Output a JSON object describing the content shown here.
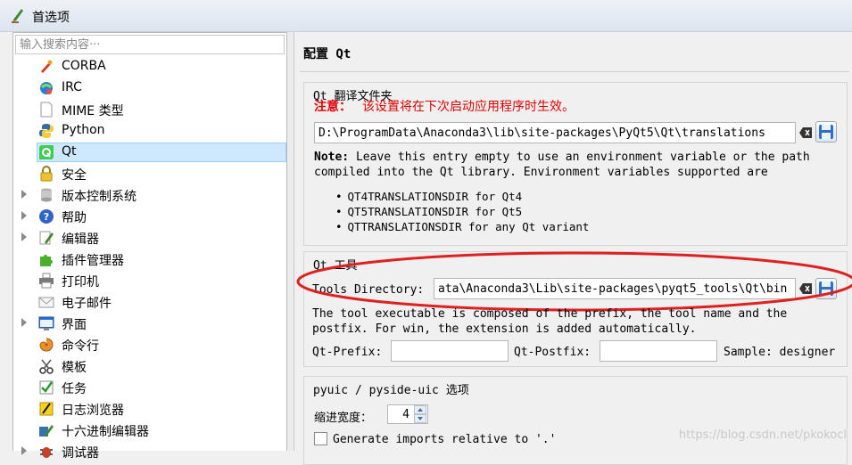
{
  "window": {
    "title": "首选项"
  },
  "sidebar": {
    "search_placeholder": "输入搜索内容···",
    "items": [
      {
        "label": "CORBA",
        "icon": "corba-icon",
        "expandable": false,
        "selected": false
      },
      {
        "label": "IRC",
        "icon": "irc-icon",
        "expandable": false,
        "selected": false
      },
      {
        "label": "MIME 类型",
        "icon": "mime-icon",
        "expandable": false,
        "selected": false
      },
      {
        "label": "Python",
        "icon": "python-icon",
        "expandable": false,
        "selected": false
      },
      {
        "label": "Qt",
        "icon": "qt-icon",
        "expandable": false,
        "selected": true
      },
      {
        "label": "安全",
        "icon": "lock-icon",
        "expandable": false,
        "selected": false
      },
      {
        "label": "版本控制系统",
        "icon": "vcs-icon",
        "expandable": true,
        "selected": false
      },
      {
        "label": "帮助",
        "icon": "help-icon",
        "expandable": true,
        "selected": false
      },
      {
        "label": "编辑器",
        "icon": "editor-icon",
        "expandable": true,
        "selected": false
      },
      {
        "label": "插件管理器",
        "icon": "plugin-icon",
        "expandable": false,
        "selected": false
      },
      {
        "label": "打印机",
        "icon": "printer-icon",
        "expandable": false,
        "selected": false
      },
      {
        "label": "电子邮件",
        "icon": "email-icon",
        "expandable": false,
        "selected": false
      },
      {
        "label": "界面",
        "icon": "interface-icon",
        "expandable": true,
        "selected": false
      },
      {
        "label": "命令行",
        "icon": "shell-icon",
        "expandable": false,
        "selected": false
      },
      {
        "label": "模板",
        "icon": "templates-icon",
        "expandable": false,
        "selected": false
      },
      {
        "label": "任务",
        "icon": "tasks-icon",
        "expandable": false,
        "selected": false
      },
      {
        "label": "日志浏览器",
        "icon": "log-icon",
        "expandable": false,
        "selected": false
      },
      {
        "label": "十六进制编辑器",
        "icon": "hex-icon",
        "expandable": false,
        "selected": false
      },
      {
        "label": "调试器",
        "icon": "debugger-icon",
        "expandable": true,
        "selected": false
      }
    ]
  },
  "main": {
    "page_title": "配置 Qt",
    "translation_group": {
      "title": "Qt 翻译文件夹",
      "notice_label": "注意：",
      "notice_text": "该设置将在下次启动应用程序时生效。",
      "path_value": "D:\\ProgramData\\Anaconda3\\lib\\site-packages\\PyQt5\\Qt\\translations",
      "note_label": "Note:",
      "note_line1": " Leave this entry empty to use an environment variable or the path",
      "note_line2": "compiled into the Qt library. Environment variables supported are",
      "env_vars": [
        "QT4TRANSLATIONSDIR for Qt4",
        "QT5TRANSLATIONSDIR for Qt5",
        "QTTRANSLATIONSDIR for any Qt variant"
      ]
    },
    "tools_group": {
      "title": "Qt 工具",
      "dir_label": "Tools Directory:",
      "dir_value": "ata\\Anaconda3\\Lib\\site-packages\\pyqt5_tools\\Qt\\bin",
      "desc_line1": "The tool executable is composed of the prefix, the tool name and the",
      "desc_line2": "postfix. For win, the extension is added automatically.",
      "prefix_label": "Qt-Prefix:",
      "prefix_value": "",
      "postfix_label": "Qt-Postfix:",
      "postfix_value": "",
      "sample_label": "Sample: designer"
    },
    "pyuic_group": {
      "title": "pyuic / pyside-uic 选项",
      "indent_label": "缩进宽度：",
      "indent_value": "4",
      "generate_label": "Generate imports relative to '.'",
      "generate_checked": false
    }
  },
  "watermark": "https://blog.csdn.net/pkokocl",
  "colors": {
    "selection": "#cde8ff",
    "notice_red": "#e00000",
    "annotation_red": "#e02020"
  }
}
